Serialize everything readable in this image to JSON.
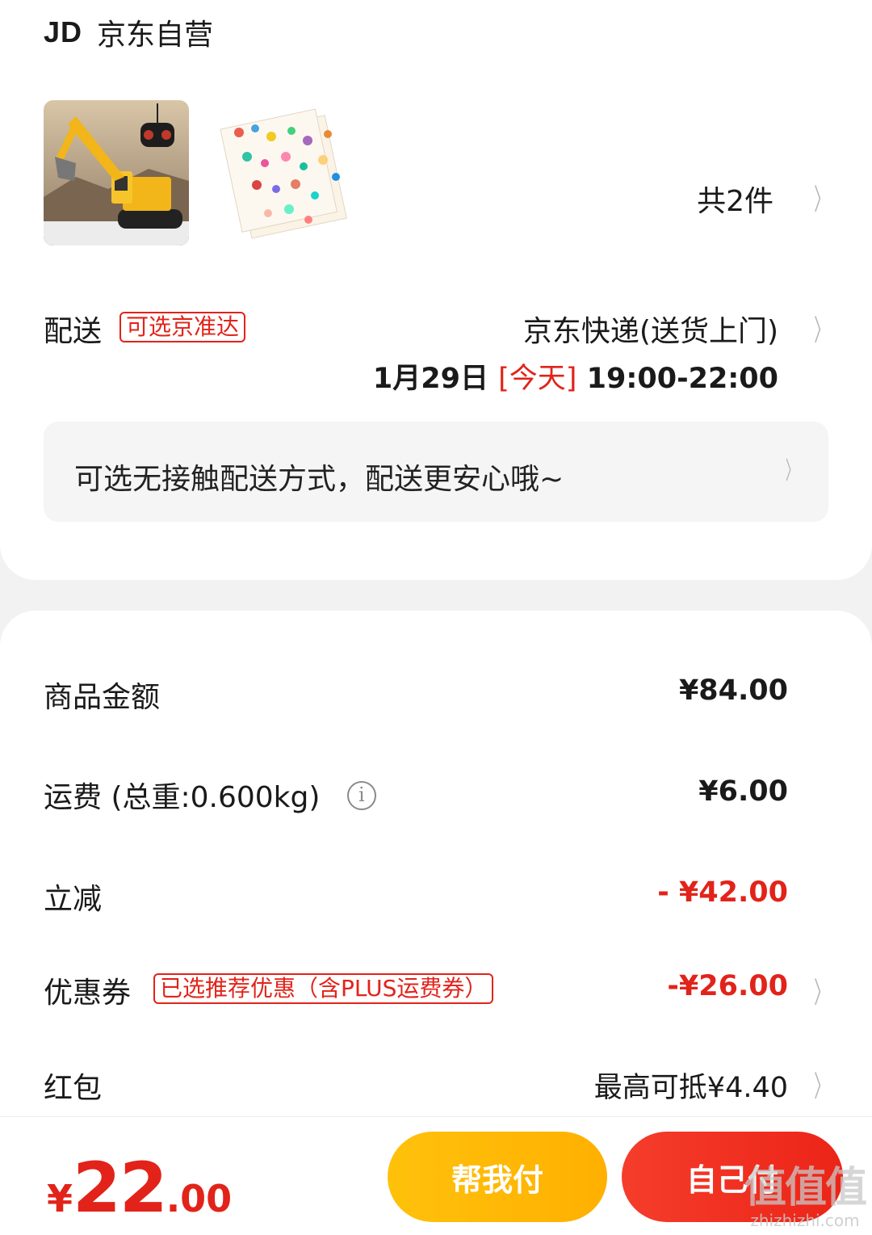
{
  "store": {
    "logo": "JD",
    "name": "京东自营"
  },
  "items": {
    "thumbnails": [
      {
        "name": "excavator-toy"
      },
      {
        "name": "sticker-sheets"
      }
    ],
    "count_label": "共2件"
  },
  "delivery": {
    "label": "配送",
    "tag": "可选京准达",
    "method": "京东快递(送货上门)",
    "date": "1月29日",
    "today": "[今天]",
    "time": "19:00-22:00",
    "notice": "可选无接触配送方式，配送更安心哦~"
  },
  "summary": {
    "goods_label": "商品金额",
    "goods_value": "¥84.00",
    "shipping_label": "运费 (总重:0.600kg)",
    "shipping_value": "¥6.00",
    "discount_label": "立减",
    "discount_value": "- ¥42.00",
    "coupon_label": "优惠券",
    "coupon_tag": "已选推荐优惠（含PLUS运费券）",
    "coupon_value": "-¥26.00",
    "redpacket_label": "红包",
    "redpacket_value": "最高可抵¥4.40"
  },
  "footer": {
    "currency": "¥",
    "total_int": "22",
    "total_dec": ".00",
    "help_pay": "帮我付",
    "self_pay": "自己付"
  },
  "watermark": {
    "logo": "值值值",
    "url": "zhizhizhi.com"
  },
  "colors": {
    "accent_red": "#e2231a",
    "help_btn": "#ffb800",
    "self_btn": "#f0301e"
  }
}
